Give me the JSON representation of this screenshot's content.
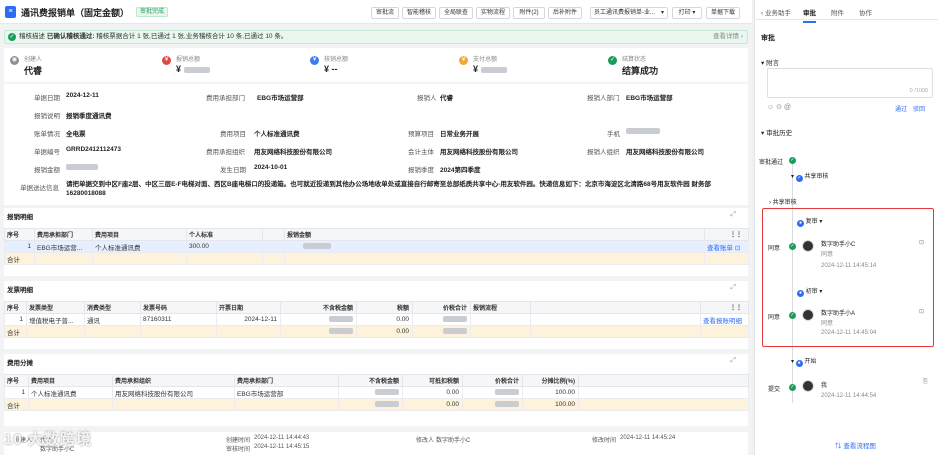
{
  "header": {
    "title": "通讯费报销单（固定金额）",
    "status_badge": "审批完成",
    "buttons": [
      "审批流",
      "智能稽核",
      "全局联查",
      "实物流程",
      "附件(2)",
      "后补附件"
    ],
    "print_template": "员工通讯费报销单-业...",
    "print_button": "打印",
    "download_button": "单据下载"
  },
  "banner": {
    "prefix": "稽核描述",
    "strong": "已确认稽核通过:",
    "text": "稽核票据合计 1 张,已通过 1 张,业务稽核合计 10 条,已通过 10 条。",
    "link": "查看详情"
  },
  "summary": [
    {
      "label": "创建人",
      "value": "代睿",
      "icon": "user-icon",
      "color": "#8a8f99"
    },
    {
      "label": "报销总额",
      "value": "",
      "icon": "money-icon",
      "color": "#e04848"
    },
    {
      "label": "核销总额",
      "value": "--",
      "icon": "coin-icon",
      "color": "#3a7cf0"
    },
    {
      "label": "支付总额",
      "value": "",
      "icon": "pay-icon",
      "color": "#f0a93a"
    },
    {
      "label": "结算状态",
      "value": "结算成功",
      "icon": "settle-icon",
      "color": "#1a9c5b"
    }
  ],
  "form": {
    "r1": [
      {
        "label": "单据日期",
        "value": "2024-12-11"
      },
      {
        "label": "费用承担部门",
        "value": "EBG市场运营部"
      },
      {
        "label": "报销人",
        "value": "代睿"
      },
      {
        "label": "报销人部门",
        "value": "EBG市场运营部"
      }
    ],
    "r2": [
      {
        "label": "报销说明",
        "value": "报销季度通讯费"
      }
    ],
    "r3": [
      {
        "label": "账单情况",
        "value": "全电票"
      },
      {
        "label": "费用项目",
        "value": "个人标准通讯费"
      },
      {
        "label": "预算项目",
        "value": "日常业务开展"
      },
      {
        "label": "手机",
        "value": ""
      }
    ],
    "r4": [
      {
        "label": "单据编号",
        "value": "GRRD2412112473"
      },
      {
        "label": "费用承担组织",
        "value": "用友网络科技股份有限公司"
      },
      {
        "label": "会计主体",
        "value": "用友网络科技股份有限公司"
      },
      {
        "label": "报销人组织",
        "value": "用友网络科技股份有限公司"
      }
    ],
    "r5": [
      {
        "label": "报销金额",
        "value": ""
      },
      {
        "label": "发生日期",
        "value": "2024-10-01"
      },
      {
        "label": "报销季度",
        "value": "2024第四季度"
      }
    ],
    "r6": {
      "label": "单据送达信息",
      "value": "请把单据交到中区F座2层、中区三层E-F电梯对面、西区B座电梯口的投递箱。也可就近投递到其他办公场地收单处或直接自行邮寄至总部纸质共享中心-用友软件园。快递信息如下：北京市海淀区北清路68号用友软件园 财务部 16280018088"
    }
  },
  "expense_detail": {
    "title": "报销明细",
    "columns": [
      "序号",
      "费用承担部门",
      "费用项目",
      "个人标准",
      "",
      "报销金额"
    ],
    "rows": [
      [
        "1",
        "EBG市场运营...",
        "个人标准通讯费",
        "300.00",
        "",
        ""
      ]
    ],
    "action": "查看账单",
    "total_label": "合计"
  },
  "invoice_detail": {
    "title": "发票明细",
    "columns": [
      "序号",
      "发票类型",
      "消费类型",
      "发票号码",
      "开票日期",
      "不含税金额",
      "税额",
      "价税合计",
      "报销流程"
    ],
    "rows": [
      [
        "1",
        "增值税电子普...",
        "通讯",
        "87160311",
        "2024-12-11",
        "",
        "0.00",
        "",
        ""
      ]
    ],
    "action": "查看报账明细",
    "total_label": "合计",
    "total_tax": "0.00"
  },
  "cost_share": {
    "title": "费用分摊",
    "columns": [
      "序号",
      "费用项目",
      "费用承担组织",
      "费用承担部门",
      "不含税金额",
      "可抵扣税额",
      "价税合计",
      "分摊比例(%)"
    ],
    "rows": [
      [
        "1",
        "个人标准通讯费",
        "用友网络科技股份有限公司",
        "EBG市场运营部",
        "",
        "0.00",
        "",
        "100.00"
      ]
    ],
    "total_label": "合计",
    "total_deduct": "0.00",
    "total_ratio": "100.00"
  },
  "footer": {
    "creator_label": "创建人",
    "creator": "代睿",
    "creator_suffix": "数字助手小C",
    "created_label": "创建时间",
    "created": "2024-12-11 14:44:43",
    "audit_label": "审核时间",
    "audit": "2024-12-11 14:45:15",
    "modifier_label": "修改人",
    "modifier": "数字助手小C",
    "modified_label": "修改时间",
    "modified": "2024-12-11 14:45:24"
  },
  "watermark": "10 大数跨境",
  "right": {
    "tabs": [
      "业务助手",
      "审批",
      "附件",
      "协作"
    ],
    "approve_title": "审批",
    "attach_label": "附言",
    "counter": "0 /1000",
    "btn_send": "通过",
    "btn_reject": "驳回",
    "history_title": "审批历史",
    "history": {
      "passed_label": "审批通过",
      "group1": "共享审核",
      "group2": "共享审核",
      "review": "复审",
      "review_action": "同意",
      "review_user": "数字助手小C",
      "review_comment": "同意",
      "review_time": "2024-12-11 14:45:14",
      "first": "初审",
      "first_action": "同意",
      "first_user": "数字助手小A",
      "first_comment": "同意",
      "first_time": "2024-12-11 14:45:04",
      "start": "开始",
      "submit_action": "提交",
      "submit_user": "我",
      "submit_time": "2024-12-11 14:44:54"
    },
    "flow_link": "查看流程图"
  }
}
